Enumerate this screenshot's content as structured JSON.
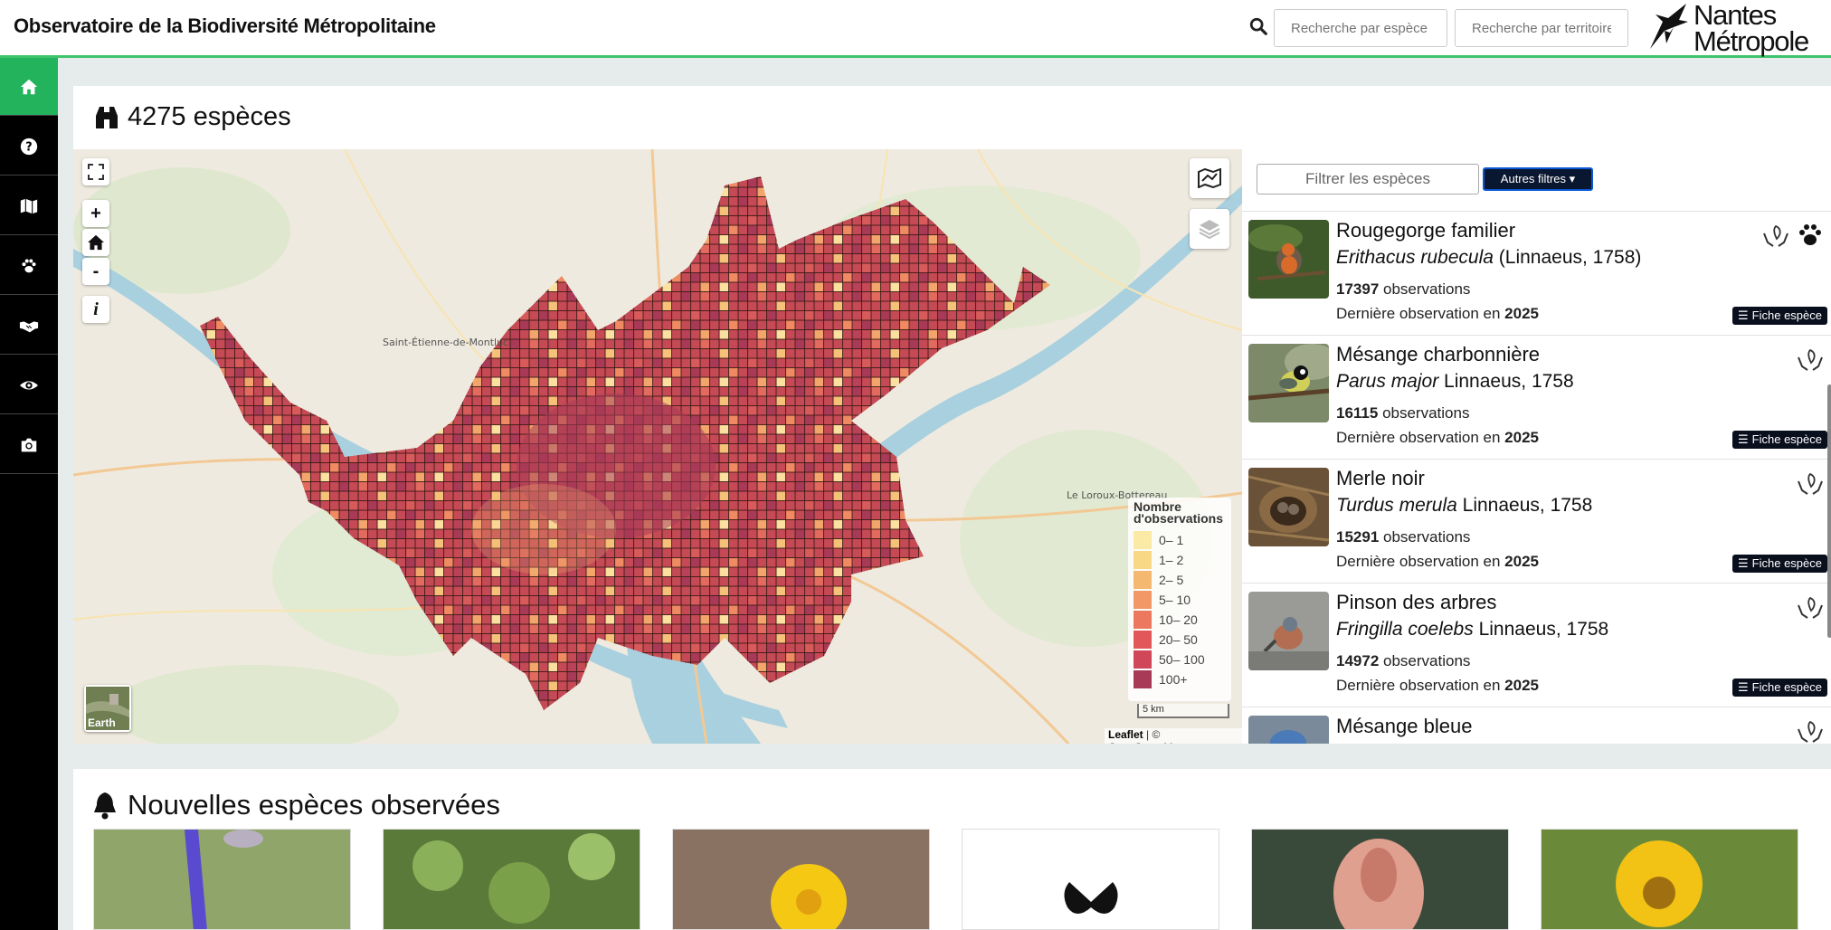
{
  "header": {
    "site_title": "Observatoire de la Biodiversité Métropolitaine",
    "search_species_placeholder": "Recherche par espèce",
    "search_territory_placeholder": "Recherche par territoire",
    "logo_line1": "Nantes",
    "logo_line2": "Métropole"
  },
  "sidebar": {
    "items": [
      {
        "icon": "home-icon",
        "active": true
      },
      {
        "icon": "question-icon"
      },
      {
        "icon": "map-icon"
      },
      {
        "icon": "paw-icon"
      },
      {
        "icon": "handshake-icon"
      },
      {
        "icon": "eye-icon"
      },
      {
        "icon": "camera-icon"
      }
    ]
  },
  "species_panel": {
    "title": "4275 espèces",
    "filter_placeholder": "Filtrer les espèces",
    "filter_button": "Autres filtres"
  },
  "map": {
    "zoom_in": "+",
    "zoom_out": "-",
    "info": "i",
    "legend_title_line1": "Nombre",
    "legend_title_line2": "d'observations",
    "legend": [
      {
        "label": "0– 1",
        "color": "#fbe9a6"
      },
      {
        "label": "1– 2",
        "color": "#f8d785"
      },
      {
        "label": "2– 5",
        "color": "#f5b870"
      },
      {
        "label": "5– 10",
        "color": "#f19866"
      },
      {
        "label": "10– 20",
        "color": "#ec7860"
      },
      {
        "label": "20– 50",
        "color": "#e2585a"
      },
      {
        "label": "50– 100",
        "color": "#cf4758"
      },
      {
        "label": "100+",
        "color": "#a83a58"
      }
    ],
    "scale_label": "5 km",
    "attribution_leaflet": "Leaflet",
    "attribution_rest": " | © OpenStreetMap",
    "earth_label": "Earth",
    "place_labels": [
      {
        "text": "Saint-Étienne-de-Montluc"
      },
      {
        "text": "Le Loroux-Bottereau"
      }
    ]
  },
  "species": [
    {
      "name": "Rougegorge familier",
      "sci_name": "Erithacus rubecula",
      "author": " (Linnaeus, 1758)",
      "obs_count": "17397",
      "obs_label": " observations",
      "last_label": "Dernière observation en ",
      "last_year": "2025",
      "button": "Fiche espèce",
      "icons": [
        "protected-hands-icon",
        "paw-icon"
      ]
    },
    {
      "name": "Mésange charbonnière",
      "sci_name": "Parus major",
      "author": " Linnaeus, 1758",
      "obs_count": "16115",
      "obs_label": " observations",
      "last_label": "Dernière observation en ",
      "last_year": "2025",
      "button": "Fiche espèce",
      "icons": [
        "protected-hands-icon"
      ]
    },
    {
      "name": "Merle noir",
      "sci_name": "Turdus merula",
      "author": " Linnaeus, 1758",
      "obs_count": "15291",
      "obs_label": " observations",
      "last_label": "Dernière observation en ",
      "last_year": "2025",
      "button": "Fiche espèce",
      "icons": [
        "protected-hands-icon"
      ]
    },
    {
      "name": "Pinson des arbres",
      "sci_name": "Fringilla coelebs",
      "author": " Linnaeus, 1758",
      "obs_count": "14972",
      "obs_label": " observations",
      "last_label": "Dernière observation en ",
      "last_year": "2025",
      "button": "Fiche espèce",
      "icons": [
        "protected-hands-icon"
      ]
    },
    {
      "name": "Mésange bleue",
      "icons": [
        "protected-hands-icon"
      ]
    }
  ],
  "new_species": {
    "title": "Nouvelles espèces observées"
  }
}
